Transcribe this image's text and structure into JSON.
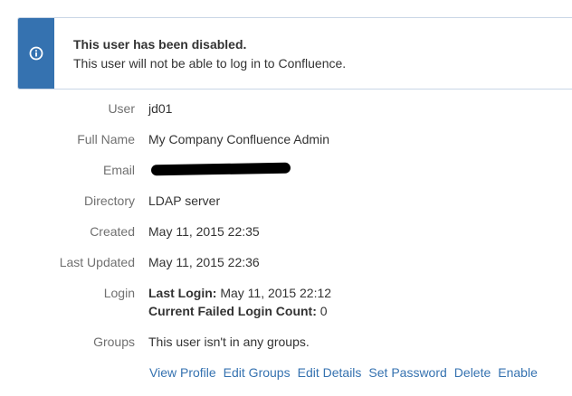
{
  "banner": {
    "icon": "info-icon",
    "title": "This user has been disabled.",
    "body": "This user will not be able to log in to Confluence."
  },
  "details": {
    "user": {
      "label": "User",
      "value": "jd01"
    },
    "full_name": {
      "label": "Full Name",
      "value": "My Company Confluence Admin"
    },
    "email": {
      "label": "Email",
      "value": ""
    },
    "directory": {
      "label": "Directory",
      "value": "LDAP server"
    },
    "created": {
      "label": "Created",
      "value": "May 11, 2015 22:35"
    },
    "last_updated": {
      "label": "Last Updated",
      "value": "May 11, 2015 22:36"
    },
    "login": {
      "label": "Login",
      "last_login_label": "Last Login:",
      "last_login_value": "May 11, 2015 22:12",
      "failed_count_label": "Current Failed Login Count:",
      "failed_count_value": "0"
    },
    "groups": {
      "label": "Groups",
      "value": "This user isn't in any groups."
    }
  },
  "actions": {
    "view_profile": "View Profile",
    "edit_groups": "Edit Groups",
    "edit_details": "Edit Details",
    "set_password": "Set Password",
    "delete": "Delete",
    "enable": "Enable"
  },
  "colors": {
    "accent": "#3572b0",
    "label": "#707070",
    "text": "#333333"
  }
}
